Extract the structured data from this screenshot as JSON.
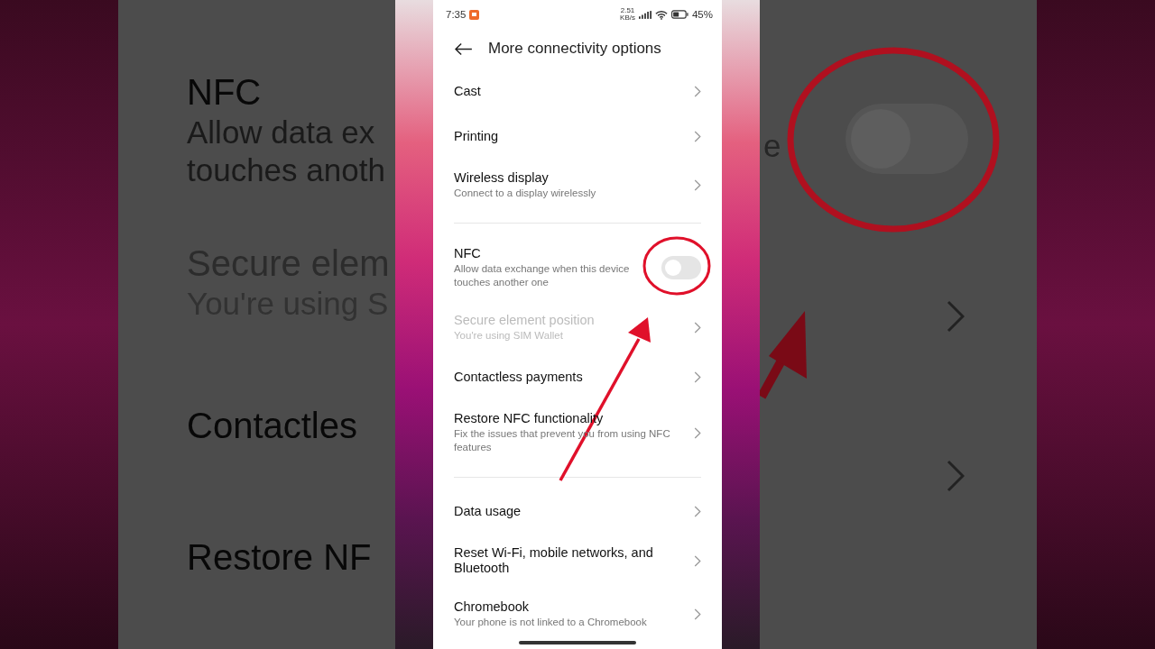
{
  "backdrop": {
    "left": [
      {
        "text": "NFC",
        "kind": "title",
        "disabled": false
      },
      {
        "text": "Allow data ex",
        "kind": "subtitle",
        "disabled": false
      },
      {
        "text": "touches anoth",
        "kind": "subtitle",
        "disabled": false
      },
      {
        "text": "Secure elem",
        "kind": "title",
        "disabled": true
      },
      {
        "text": "You're using S",
        "kind": "subtitle",
        "disabled": true
      },
      {
        "text": "Contactles",
        "kind": "title",
        "disabled": false
      },
      {
        "text": "Restore NF",
        "kind": "title",
        "disabled": false
      }
    ],
    "right_fragment": "e",
    "right_toggle_on": false
  },
  "status_bar": {
    "time": "7:35",
    "network_speed": "2.51",
    "network_unit": "KB/s",
    "battery": "45%"
  },
  "header": {
    "title": "More connectivity options"
  },
  "groups": [
    {
      "items": [
        {
          "kind": "link",
          "title": "Cast",
          "disabled": false
        },
        {
          "kind": "link",
          "title": "Printing",
          "disabled": false
        },
        {
          "kind": "link",
          "title": "Wireless display",
          "subtitle": "Connect to a display wirelessly",
          "disabled": false
        }
      ]
    },
    {
      "items": [
        {
          "kind": "toggle",
          "title": "NFC",
          "subtitle": "Allow data exchange when this device touches another one",
          "on": false,
          "disabled": false
        },
        {
          "kind": "link",
          "title": "Secure element position",
          "subtitle": "You're using SIM  Wallet",
          "disabled": true
        },
        {
          "kind": "link",
          "title": "Contactless payments",
          "disabled": false
        },
        {
          "kind": "link",
          "title": "Restore NFC functionality",
          "subtitle": "Fix the issues that prevent you from using NFC features",
          "disabled": false
        }
      ]
    },
    {
      "items": [
        {
          "kind": "link",
          "title": "Data usage",
          "disabled": false
        },
        {
          "kind": "link",
          "title": "Reset Wi-Fi, mobile networks, and Bluetooth",
          "disabled": false
        },
        {
          "kind": "link",
          "title": "Chromebook",
          "subtitle": "Your phone is not linked to a Chromebook",
          "disabled": false
        }
      ]
    }
  ]
}
